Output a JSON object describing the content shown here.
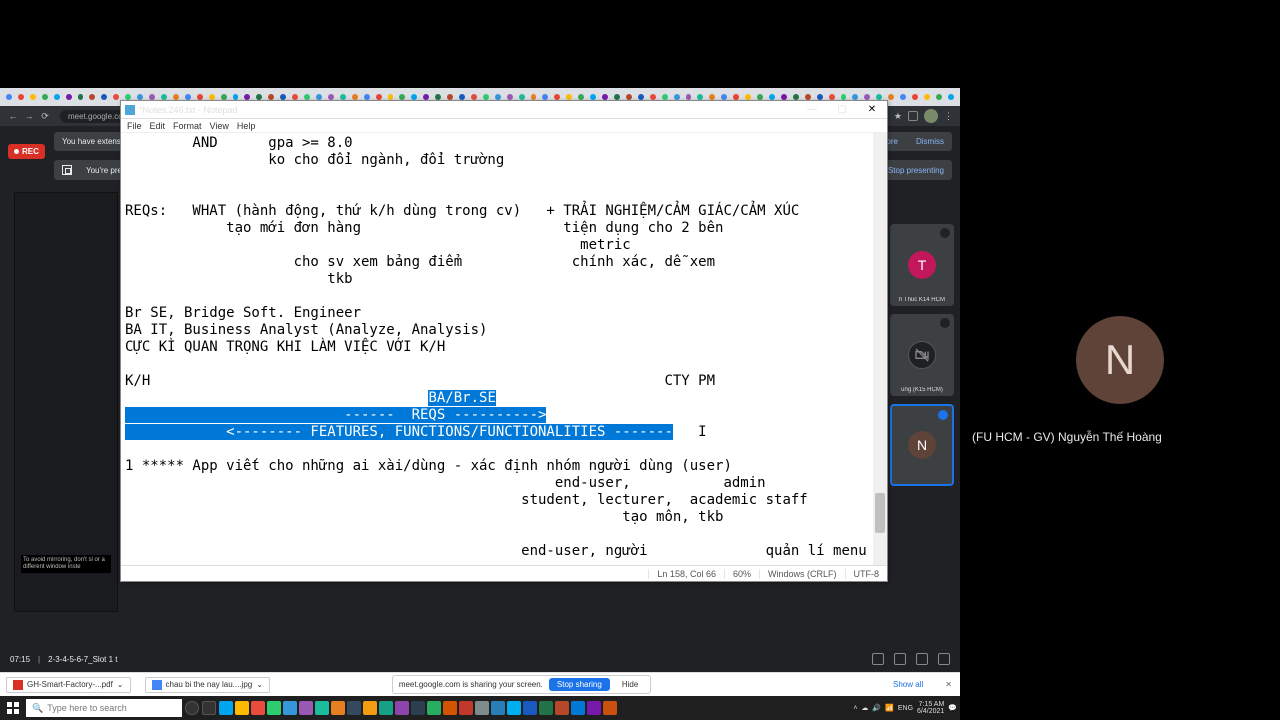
{
  "browser": {
    "url": "meet.google.co",
    "nav_back": "←",
    "nav_fwd": "→",
    "nav_reload": "⟳",
    "menu_dots": "⋮"
  },
  "meet": {
    "rec_label": "REC",
    "banner1_text": "You have extensio",
    "banner1_more": "more",
    "banner1_dismiss": "Dismiss",
    "banner2_text": "You're pres",
    "banner2_action": "Stop presenting",
    "footer_time": "07:15",
    "footer_title": "2-3-4-5-6-7_Slot 1 t",
    "mini_warn": "To avoid mirroring, don't sl\nor a different window inste",
    "tiles": [
      {
        "initial": "T",
        "label": "h Thuc K14 HCM"
      },
      {
        "initial": "",
        "label": "ung (K15 HCM)"
      },
      {
        "initial": "N",
        "label": ""
      }
    ]
  },
  "notepad": {
    "title": "*Notes.246.txt - Notepad",
    "menu": [
      "File",
      "Edit",
      "Format",
      "View",
      "Help"
    ],
    "win_min": "—",
    "win_max": "▢",
    "win_close": "✕",
    "lines_pre": "        AND      gpa >= 8.0\n                 ko cho đổi ngành, đổi trường\n\n\nREQs:   WHAT (hành động, thứ k/h dùng trong cv)   + TRẢI NGHIỆM/CẢM GIÁC/CẢM XÚC\n            tạo mới đơn hàng                        tiện dụng cho 2 bên\n                                                      metric\n                    cho sv xem bảng điểm             chính xác, dễ xem\n                        tkb\n\nBr SE, Bridge Soft. Engineer\nBA IT, Business Analyst (Analyze, Analysis)\nCỰC KÌ QUAN TRỌNG KHI LÀM VIỆC VỚI K/H\n\nK/H                                                             CTY PM",
    "sel1": "BA/Br.SE",
    "sel2": "                          ------  REQS ---------->",
    "sel3": "            <-------- FEATURES, FUNCTIONS/FUNCTIONALITIES -------",
    "lines_post": "\n\n1 ***** App viết cho những ai xài/dùng - xác định nhóm người dùng (user)\n                                                   end-user,           admin\n                                               student, lecturer,  academic staff\n                                                           tạo môn, tkb\n\n                                               end-user, người              quản lí menu",
    "status": {
      "pos": "Ln 158, Col 66",
      "zoom": "60%",
      "eol": "Windows (CRLF)",
      "enc": "UTF-8"
    }
  },
  "sharebar": {
    "dl1": "GH-Smart-Factory-...pdf",
    "dl2": "chau bi the nay lau....jpg",
    "msg": "meet.google.com is sharing your screen.",
    "stop": "Stop sharing",
    "hide": "Hide",
    "showall": "Show all",
    "close": "✕"
  },
  "taskbar": {
    "search_placeholder": "Type here to search",
    "lang": "ENG",
    "time": "7:15 AM",
    "date": "6/4/2021",
    "icon_colors": [
      "#00a4ef",
      "#ffb900",
      "#e74c3c",
      "#2ecc71",
      "#3498db",
      "#9b59b6",
      "#1abc9c",
      "#e67e22",
      "#34495e",
      "#f39c12",
      "#16a085",
      "#8e44ad",
      "#2c3e50",
      "#27ae60",
      "#d35400",
      "#c0392b",
      "#7f8c8d",
      "#2980b9",
      "#00adef",
      "#185abd",
      "#217346",
      "#b7472a",
      "#0078d4",
      "#7719aa",
      "#ca5010"
    ]
  },
  "sidebar": {
    "initial": "N",
    "name": "(FU HCM - GV) Nguyễn Thế Hoàng"
  }
}
